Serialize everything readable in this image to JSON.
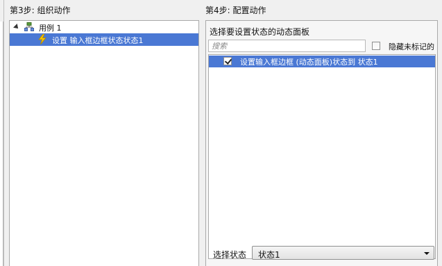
{
  "step3": {
    "title": "第3步: 组织动作",
    "tree": {
      "case": {
        "label": "用例 1",
        "icon": "case-tree-icon"
      },
      "action": {
        "label": "设置 输入框边框状态状态1",
        "icon": "lightning-bolt-icon",
        "selected": true
      }
    }
  },
  "step4": {
    "title": "第4步: 配置动作",
    "heading": "选择要设置状态的动态面板",
    "search": {
      "placeholder": "搜索",
      "value": ""
    },
    "hide_unmarked": {
      "label": "隐藏未标记的",
      "checked": false
    },
    "panels": [
      {
        "label": "设置输入框边框 (动态面板)状态到 状态1",
        "checked": true,
        "selected": true
      }
    ],
    "select_state": {
      "label": "选择状态",
      "value": "状态1"
    }
  },
  "colors": {
    "selection": "#4a78d4",
    "background": "#f0f0f0",
    "border": "#a9a9a9"
  }
}
